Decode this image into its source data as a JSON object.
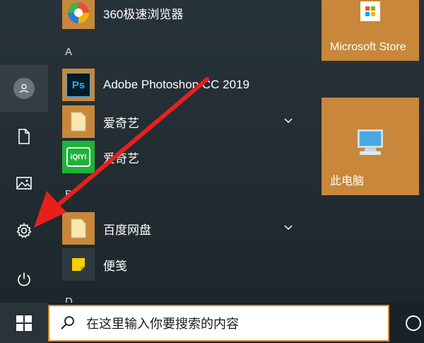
{
  "app_list": {
    "items": [
      {
        "label": "360极速浏览器"
      },
      {
        "label": "Adobe Photoshop CC 2019",
        "tile_text": "Ps"
      },
      {
        "label": "爱奇艺"
      },
      {
        "label": "爱奇艺",
        "tile_text": "iQIYI"
      },
      {
        "label": "百度网盘"
      },
      {
        "label": "便笺"
      }
    ],
    "letters": [
      "A",
      "B",
      "D"
    ]
  },
  "tiles": {
    "store": {
      "label": "Microsoft Store"
    },
    "pc": {
      "label": "此电脑"
    }
  },
  "taskbar": {
    "search_placeholder": "在这里输入你要搜索的内容"
  },
  "colors": {
    "accent": "#c8873a",
    "annotation_arrow": "#e8201c"
  }
}
